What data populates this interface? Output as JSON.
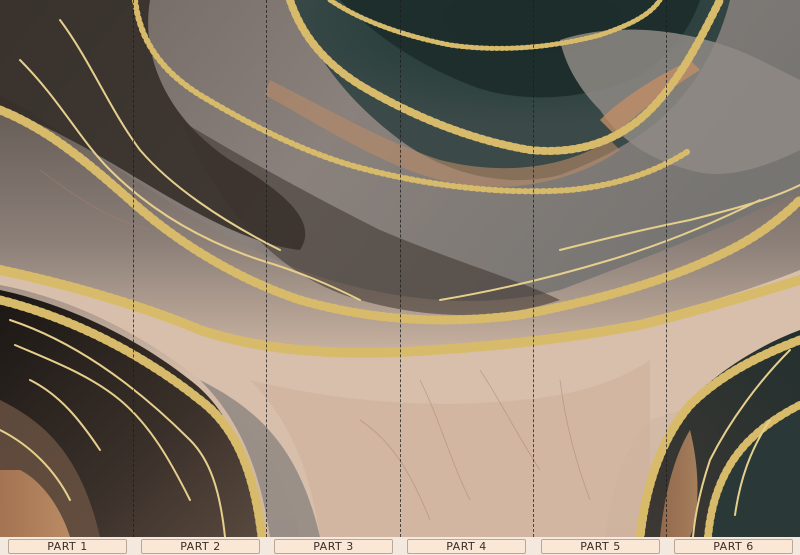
{
  "panels": [
    {
      "label": "PART 1"
    },
    {
      "label": "PART 2"
    },
    {
      "label": "PART 3"
    },
    {
      "label": "PART 4"
    },
    {
      "label": "PART 5"
    },
    {
      "label": "PART 6"
    }
  ],
  "colors": {
    "label_background": "#fae7d6",
    "seam": "#1c1c1c",
    "gold": "#d8bb6a",
    "dark_smoke": "#3b332e",
    "teal": "#26403f",
    "sand": "#d4b8a2"
  }
}
